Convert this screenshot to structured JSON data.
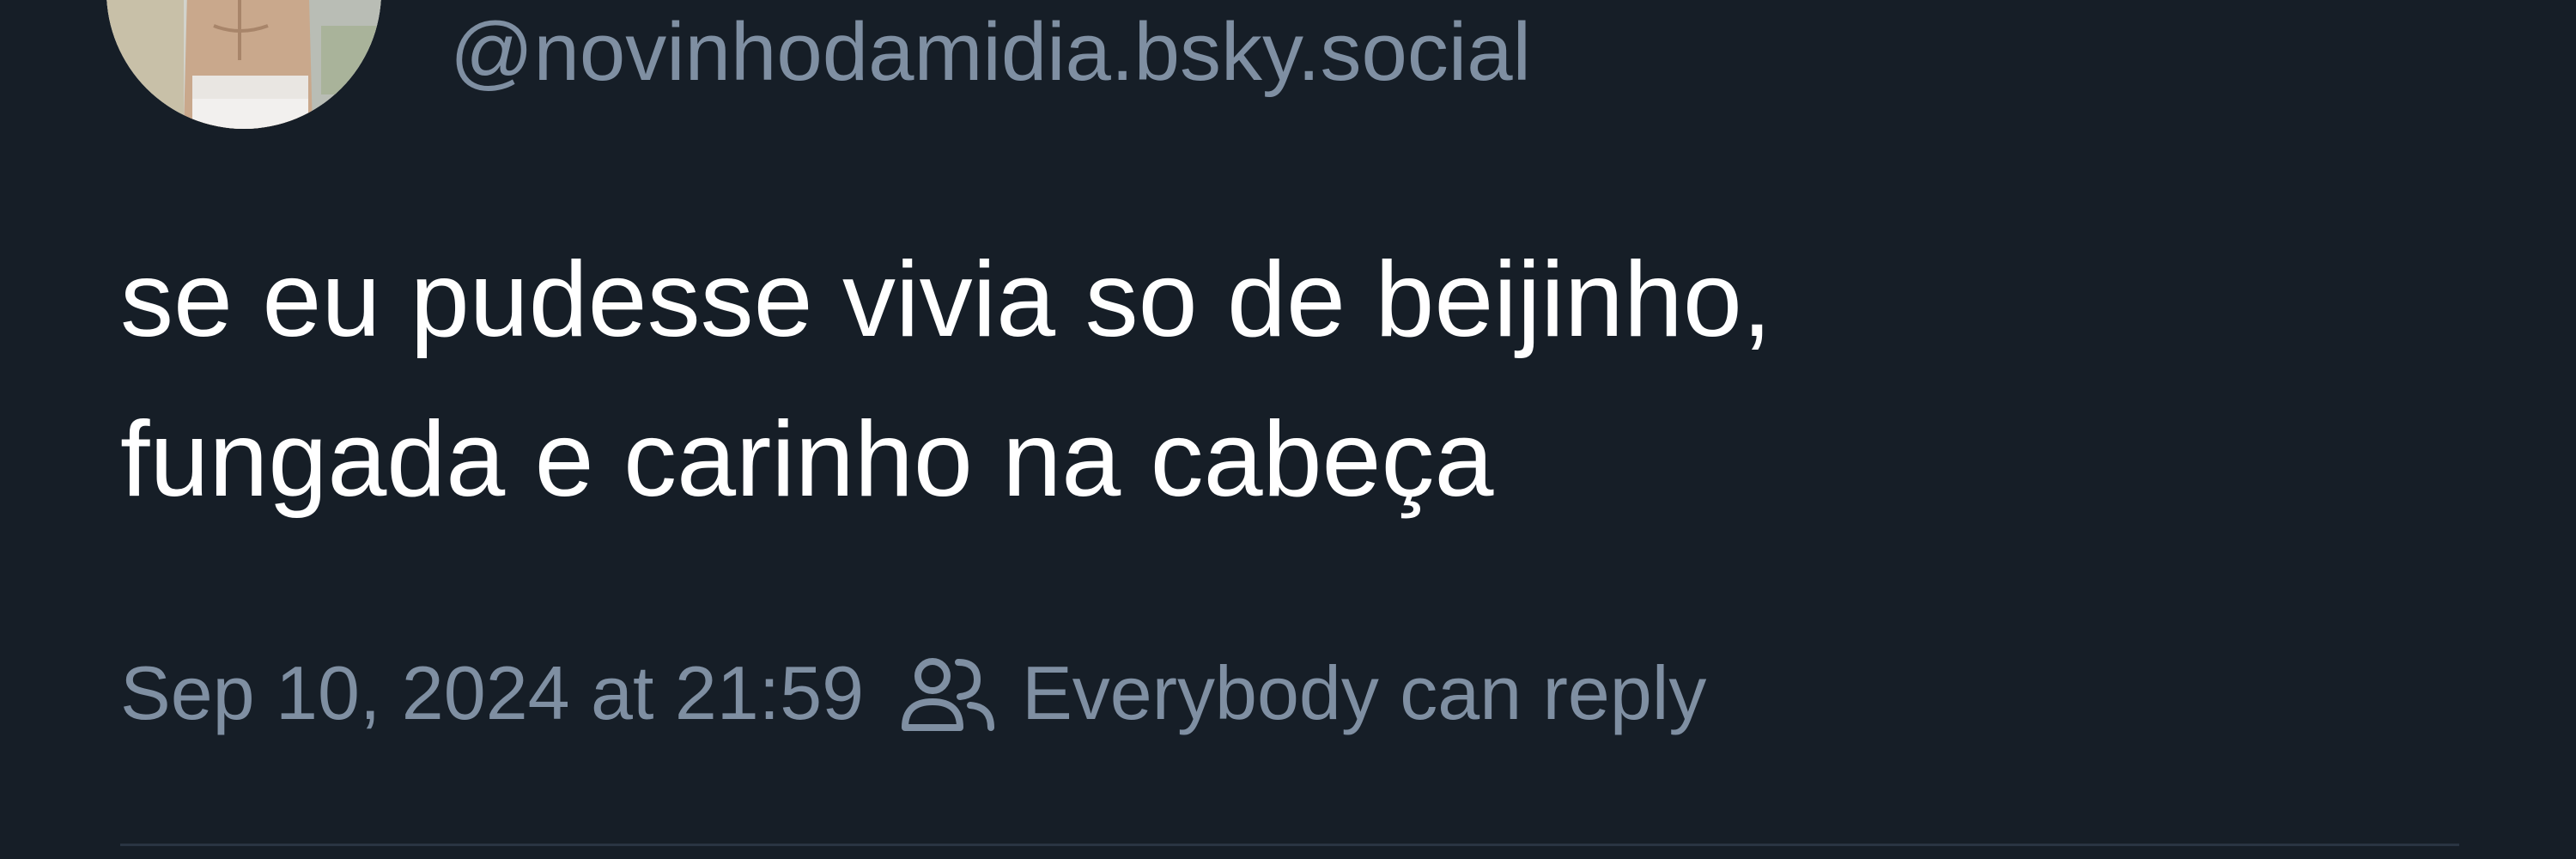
{
  "author": {
    "handle": "@novinhodamidia.bsky.social",
    "avatar_icon": "profile-photo-avatar"
  },
  "post": {
    "text_lines": [
      "se eu pudesse vivia so de beijinho,",
      "fungada e carinho na cabeça"
    ]
  },
  "meta": {
    "timestamp": "Sep 10, 2024 at 21:59",
    "reply_icon": "people-icon",
    "reply_setting": "Everybody can reply"
  },
  "colors": {
    "background": "#161e27",
    "text": "#ffffff",
    "muted": "#7f8fa2",
    "divider": "#2a3542"
  }
}
